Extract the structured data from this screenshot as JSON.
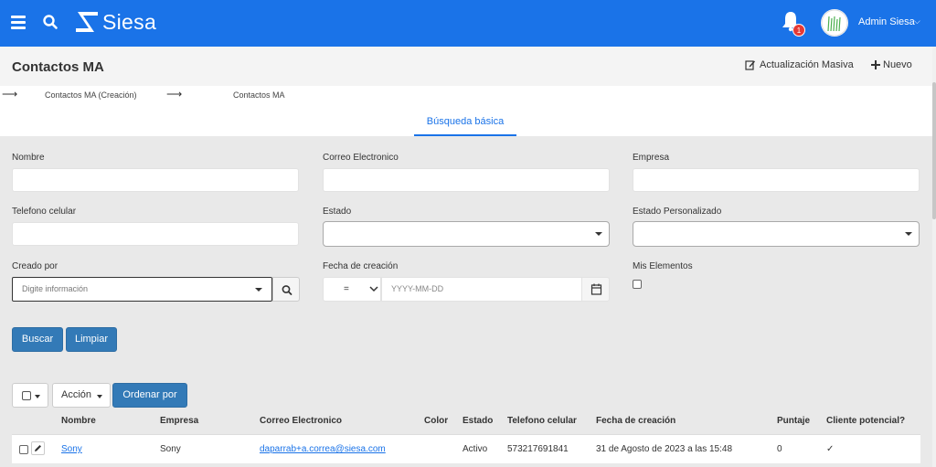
{
  "topbar": {
    "brand": "Siesa",
    "notification_count": "1",
    "user_name": "Admin Siesa",
    "user_chevron": "⌵"
  },
  "header": {
    "title": "Contactos MA",
    "mass_update_label": "Actualización Masiva",
    "new_label": "Nuevo"
  },
  "breadcrumbs": [
    {
      "label": "Contactos MA (Creación)"
    },
    {
      "label": "Contactos MA"
    }
  ],
  "tabs": {
    "basic_search": "Búsqueda básica"
  },
  "form": {
    "nombre_label": "Nombre",
    "correo_label": "Correo Electronico",
    "empresa_label": "Empresa",
    "telefono_label": "Telefono celular",
    "estado_label": "Estado",
    "estado_pers_label": "Estado Personalizado",
    "creado_por_label": "Creado por",
    "creado_por_placeholder": "Digite información",
    "fecha_label": "Fecha de creación",
    "fecha_operator": "=",
    "fecha_placeholder": "YYYY-MM-DD",
    "mis_elementos_label": "Mis Elementos"
  },
  "buttons": {
    "buscar": "Buscar",
    "limpiar": "Limpiar",
    "accion": "Acción",
    "ordenar": "Ordenar por"
  },
  "table": {
    "headers": {
      "nombre": "Nombre",
      "empresa": "Empresa",
      "correo": "Correo Electronico",
      "color": "Color",
      "estado": "Estado",
      "telefono": "Telefono celular",
      "fecha": "Fecha de creación",
      "puntaje": "Puntaje",
      "cliente": "Cliente potencial?"
    },
    "rows": [
      {
        "nombre": "Sony",
        "empresa": "Sony",
        "correo": "daparrab+a.correa@siesa.com",
        "estado": "Activo",
        "telefono": "573217691841",
        "fecha": "31 de Agosto de 2023 a las 15:48",
        "puntaje": "0",
        "cliente": "✓"
      }
    ]
  }
}
